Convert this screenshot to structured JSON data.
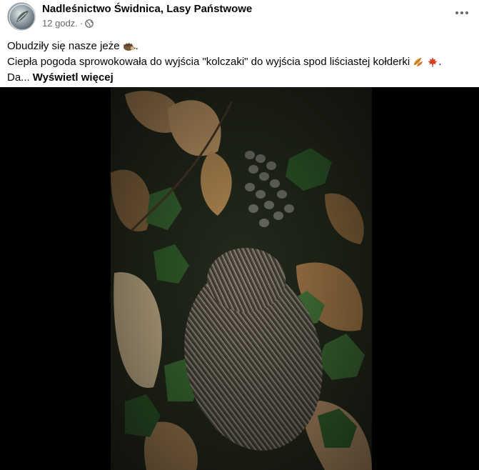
{
  "post": {
    "page_name": "Nadleśnictwo Świdnica, Lasy Państwowe",
    "time": "12 godz.",
    "separator": "·",
    "text_line1": "Obudziły się nasze jeże",
    "text_line2": "Ciepła pogoda sprowokowała do wyjścia \"kolczaki\" do wyjścia spod liściastej kołderki",
    "text_line2_end": ".",
    "text_line3_prefix": "Da...",
    "see_more": "Wyświetl więcej"
  },
  "icons": {
    "avatar": "avatar",
    "globe": "globe-icon",
    "more": "more-options-icon",
    "emoji1": "hedgehog-emoji",
    "emoji2": "fallen-leaf-emoji",
    "emoji3": "maple-leaf-emoji"
  },
  "media": {
    "description_alt": "",
    "background": "#000000"
  }
}
